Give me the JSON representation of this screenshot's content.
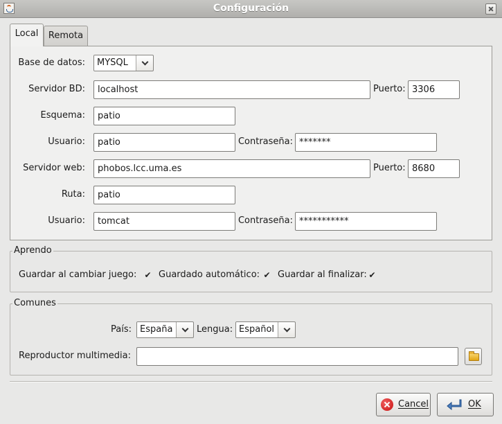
{
  "window": {
    "title": "Configuración"
  },
  "tabs": [
    {
      "label": "Local",
      "selected": true
    },
    {
      "label": "Remota",
      "selected": false
    }
  ],
  "local": {
    "base_datos": {
      "label": "Base de datos:",
      "value": "MYSQL"
    },
    "servidor_bd": {
      "label": "Servidor BD:",
      "value": "localhost"
    },
    "puerto_bd": {
      "label": "Puerto:",
      "value": "3306"
    },
    "esquema": {
      "label": "Esquema:",
      "value": "patio"
    },
    "usuario_bd": {
      "label": "Usuario:",
      "value": "patio"
    },
    "contrasena_bd": {
      "label": "Contraseña:",
      "value": "*******"
    },
    "servidor_web": {
      "label": "Servidor web:",
      "value": "phobos.lcc.uma.es"
    },
    "puerto_web": {
      "label": "Puerto:",
      "value": "8680"
    },
    "ruta": {
      "label": "Ruta:",
      "value": "patio"
    },
    "usuario_web": {
      "label": "Usuario:",
      "value": "tomcat"
    },
    "contrasena_web": {
      "label": "Contraseña:",
      "value": "***********"
    }
  },
  "aprendo": {
    "title": "Aprendo",
    "guardar_cambiar": {
      "label": "Guardar al cambiar juego:",
      "checked": true
    },
    "guardado_auto": {
      "label": "Guardado automático:",
      "checked": true
    },
    "guardar_finalizar": {
      "label": "Guardar al finalizar:",
      "checked": true
    },
    "check_mark": "✔"
  },
  "comunes": {
    "title": "Comunes",
    "pais": {
      "label": "País:",
      "value": "España"
    },
    "lengua": {
      "label": "Lengua:",
      "value": "Español"
    },
    "reproductor": {
      "label": "Reproductor multimedia:",
      "value": "",
      "icon": "folder-open-icon"
    }
  },
  "buttons": {
    "cancel": "Cancel",
    "ok": "OK"
  },
  "colors": {
    "cancel_icon": "#c81010",
    "ok_icon": "#3a6fb0",
    "titlebar": "#b9b8b5"
  }
}
